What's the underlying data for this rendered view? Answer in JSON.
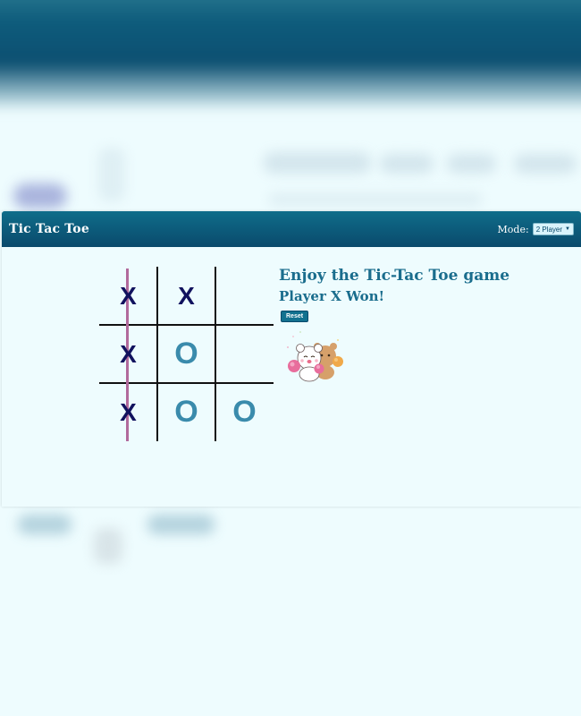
{
  "header": {
    "title": "Tic Tac Toe",
    "mode_label": "Mode:",
    "mode_selected": "2 Player"
  },
  "board": {
    "cells": [
      "X",
      "X",
      "",
      "X",
      "O",
      "",
      "X",
      "O",
      "O"
    ],
    "winning_line": "column-1",
    "colors": {
      "x": "#11125e",
      "o": "#3a8bac",
      "win_line": "#b16a9c"
    }
  },
  "panel": {
    "heading": "Enjoy the Tic-Tac Toe game",
    "status": "Player X Won!",
    "reset_label": "Reset"
  },
  "theme": {
    "header_color": "#0a4a6c",
    "accent": "#1a6d8d",
    "background": "#eefcfe"
  },
  "icons": {
    "celebration": "cheering-bears-icon"
  }
}
